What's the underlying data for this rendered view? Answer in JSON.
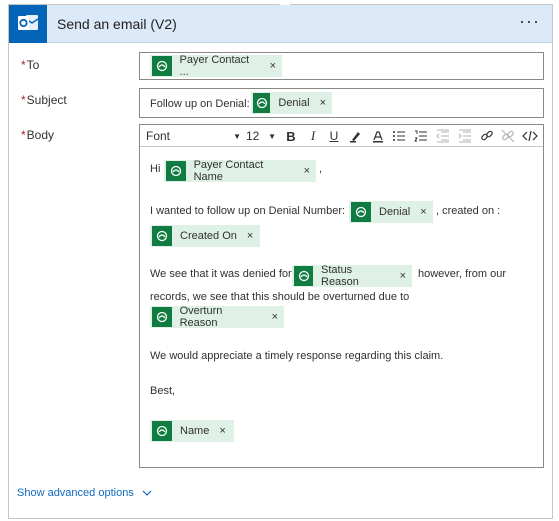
{
  "action": {
    "title": "Send an email (V2)",
    "more_label": "···"
  },
  "fields": {
    "to_label": "To",
    "subject_label": "Subject",
    "body_label": "Body",
    "required_mark": "*"
  },
  "to": {
    "token": "Payer Contact ..."
  },
  "subject": {
    "prefix": "Follow up on Denial:",
    "token": "Denial"
  },
  "toolbar": {
    "font": "Font",
    "size": "12",
    "caret": "▼"
  },
  "body": {
    "greeting": "Hi",
    "token_contact": "Payer Contact Name",
    "comma": ",",
    "line1_start": "I wanted to follow up on Denial Number:",
    "token_denial": "Denial",
    "line1_end": ", created on :",
    "token_created": "Created On",
    "line2_start": "We see that it was denied for",
    "token_status": "Status Reason",
    "line2_end": "however, from our",
    "line3": "records, we see that this should be overturned due to",
    "token_overturn": "Overturn Reason",
    "line4": "We would appreciate a timely response regarding this claim.",
    "closing": "Best,",
    "token_name": "Name"
  },
  "token_close": "×",
  "advanced": {
    "label": "Show advanced options"
  }
}
